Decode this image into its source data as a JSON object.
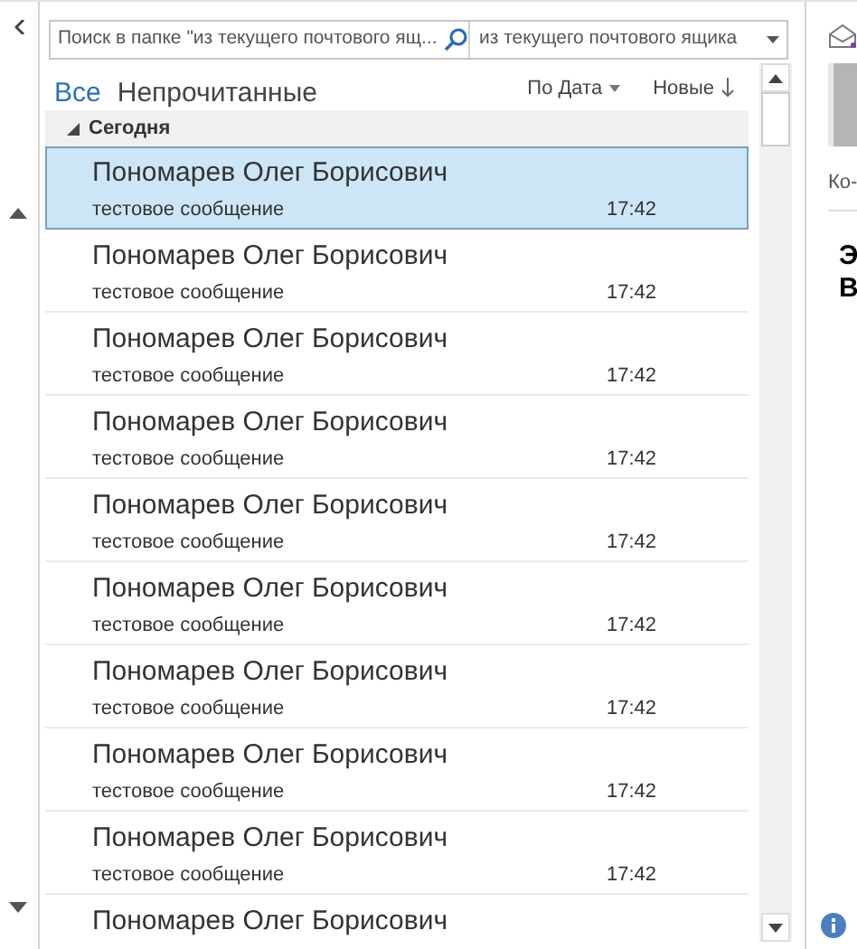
{
  "search": {
    "placeholder": "Поиск в папке \"из текущего почтового ящ...",
    "scope": "из текущего почтового ящика"
  },
  "filters": [
    {
      "label": "Все",
      "selected": true
    },
    {
      "label": "Непрочитанные",
      "selected": false
    }
  ],
  "sort": {
    "by": "По Дата",
    "order": "Новые"
  },
  "group": {
    "label": "Сегодня",
    "expanded": true
  },
  "messages": [
    {
      "sender": "Пономарев Олег Борисович",
      "subject": "тестовое сообщение",
      "time": "17:42",
      "selected": true
    },
    {
      "sender": "Пономарев Олег Борисович",
      "subject": "тестовое сообщение",
      "time": "17:42",
      "selected": false
    },
    {
      "sender": "Пономарев Олег Борисович",
      "subject": "тестовое сообщение",
      "time": "17:42",
      "selected": false
    },
    {
      "sender": "Пономарев Олег Борисович",
      "subject": "тестовое сообщение",
      "time": "17:42",
      "selected": false
    },
    {
      "sender": "Пономарев Олег Борисович",
      "subject": "тестовое сообщение",
      "time": "17:42",
      "selected": false
    },
    {
      "sender": "Пономарев Олег Борисович",
      "subject": "тестовое сообщение",
      "time": "17:42",
      "selected": false
    },
    {
      "sender": "Пономарев Олег Борисович",
      "subject": "тестовое сообщение",
      "time": "17:42",
      "selected": false
    },
    {
      "sender": "Пономарев Олег Борисович",
      "subject": "тестовое сообщение",
      "time": "17:42",
      "selected": false
    },
    {
      "sender": "Пономарев Олег Борисович",
      "subject": "тестовое сообщение",
      "time": "17:42",
      "selected": false
    },
    {
      "sender": "Пономарев Олег Борисович",
      "selected": false
    }
  ],
  "reading_pane": {
    "label": "Ко-",
    "heading_lines": [
      "Э",
      "В"
    ]
  }
}
